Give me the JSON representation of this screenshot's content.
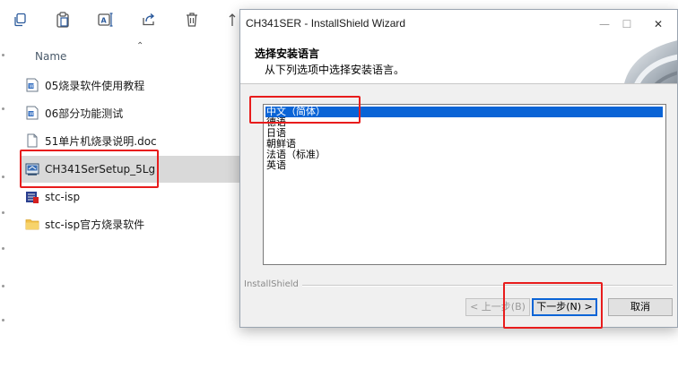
{
  "explorer": {
    "toolbar": {
      "icons": [
        "copy-icon",
        "paste-icon",
        "rename-icon",
        "share-icon",
        "delete-icon"
      ]
    },
    "column_header": {
      "name": "Name"
    },
    "files": [
      {
        "name": "05烧录软件使用教程",
        "icon": "document-icon"
      },
      {
        "name": "06部分功能测试",
        "icon": "document-icon"
      },
      {
        "name": "51单片机烧录说明.doc",
        "icon": "blank-file-icon"
      },
      {
        "name": "CH341SerSetup_5Lg",
        "icon": "installer-icon",
        "selected": true
      },
      {
        "name": "stc-isp",
        "icon": "app-icon"
      },
      {
        "name": "stc-isp官方烧录软件",
        "icon": "folder-icon"
      }
    ]
  },
  "dialog": {
    "title": "CH341SER - InstallShield Wizard",
    "header": {
      "title": "选择安装语言",
      "subtitle": "从下列选项中选择安装语言。"
    },
    "languages": [
      {
        "label": "中文（简体）",
        "selected": true
      },
      {
        "label": "德语"
      },
      {
        "label": "日语"
      },
      {
        "label": "朝鲜语"
      },
      {
        "label": "法语（标准）"
      },
      {
        "label": "英语"
      }
    ],
    "brand": "InstallShield",
    "buttons": {
      "back": "< 上一步(B)",
      "next": "下一步(N) >",
      "cancel": "取消"
    }
  },
  "colors": {
    "selection": "#0a64d6",
    "highlight_annotation": "#e81c1c",
    "explorer_selected_row": "#d9d9d9"
  }
}
